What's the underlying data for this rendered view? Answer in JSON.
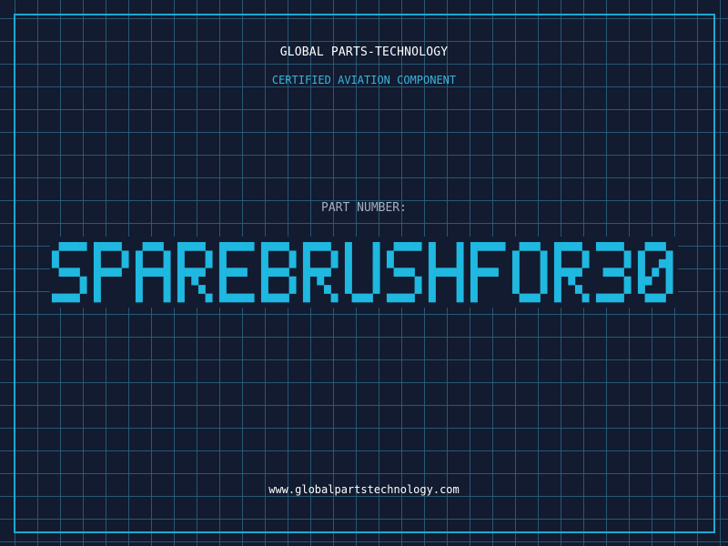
{
  "header": {
    "brand": "GLOBAL PARTS-TECHNOLOGY",
    "subtitle": "CERTIFIED AVIATION COMPONENT"
  },
  "part": {
    "label": "PART NUMBER:",
    "number": "SPAREBRUSHFOR30"
  },
  "footer": {
    "website": "www.globalpartstechnology.com"
  },
  "colors": {
    "background": "#121b2f",
    "grid": "#2b6280",
    "frame": "#1fa8d2",
    "part_number": "#1fb8e0",
    "brand_text": "#ffffff",
    "subtitle_text": "#3ab5dd",
    "label_text": "#a4afc0"
  }
}
